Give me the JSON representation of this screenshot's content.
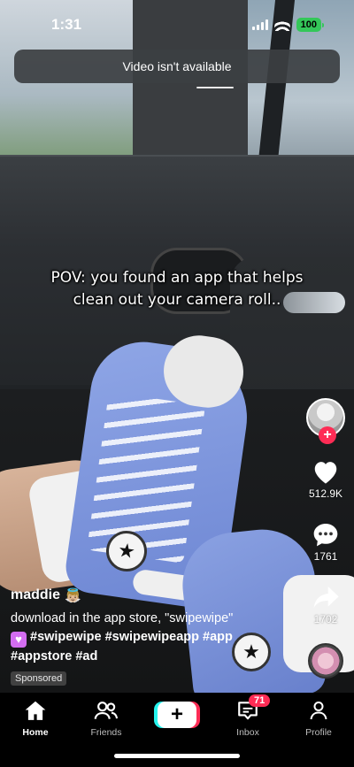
{
  "status_bar": {
    "time": "1:31",
    "battery": "100"
  },
  "toast": {
    "message": "Video isn't available"
  },
  "video": {
    "caption": "POV: you found an app that helps clean out your camera roll.."
  },
  "rail": {
    "likes": "512.9K",
    "comments": "1761",
    "shares": "1702",
    "follow_symbol": "+"
  },
  "post": {
    "username": "maddie",
    "username_emoji": "👼🏼",
    "description": "download in the app store, \"swipewipe\"",
    "hashtags_line1": "#swipewipe #swipewipeapp #app",
    "hashtags_line2": "#appstore #ad",
    "sponsored_label": "Sponsored"
  },
  "nav": {
    "home": "Home",
    "friends": "Friends",
    "create_symbol": "+",
    "inbox": "Inbox",
    "inbox_badge": "71",
    "profile": "Profile"
  },
  "colors": {
    "accent_red": "#fe2c55",
    "accent_cyan": "#25f4ee",
    "battery_green": "#34c759"
  },
  "icons": [
    "home-icon",
    "friends-icon",
    "inbox-icon",
    "profile-icon",
    "heart-icon",
    "comment-icon",
    "share-icon"
  ]
}
